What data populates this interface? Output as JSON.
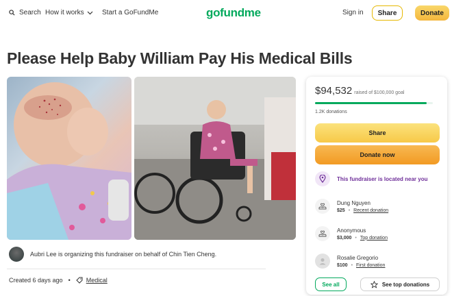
{
  "header": {
    "search_label": "Search",
    "how_it_works_label": "How it works",
    "start_label": "Start a GoFundMe",
    "logo_text": "gofundme",
    "signin_label": "Sign in",
    "share_label": "Share",
    "donate_label": "Donate"
  },
  "campaign": {
    "title": "Please Help Baby William Pay His Medical Bills",
    "organizer_text": "Aubri Lee is organizing this fundraiser on behalf of Chin Tien Cheng.",
    "created_text": "Created 6 days ago",
    "category": "Medical"
  },
  "donation_card": {
    "raised_amount": "$94,532",
    "goal_text": "raised of $100,000 goal",
    "progress_percent": 94.5,
    "donations_count": "1.2K donations",
    "share_label": "Share",
    "donate_label": "Donate now",
    "near_text": "This fundraiser is located near you",
    "donors": [
      {
        "name": "Dung Nguyen",
        "amount": "$25",
        "tag": "Recent donation"
      },
      {
        "name": "Anonymous",
        "amount": "$3,000",
        "tag": "Top donation"
      },
      {
        "name": "Rosalie Gregorio",
        "amount": "$100",
        "tag": "First donation"
      }
    ],
    "see_all_label": "See all",
    "see_top_label": "See top donations"
  },
  "colors": {
    "brand_green": "#02a95c",
    "share_yellow": "#f7c948",
    "donate_orange": "#f29a23",
    "near_purple": "#6e2e99"
  }
}
